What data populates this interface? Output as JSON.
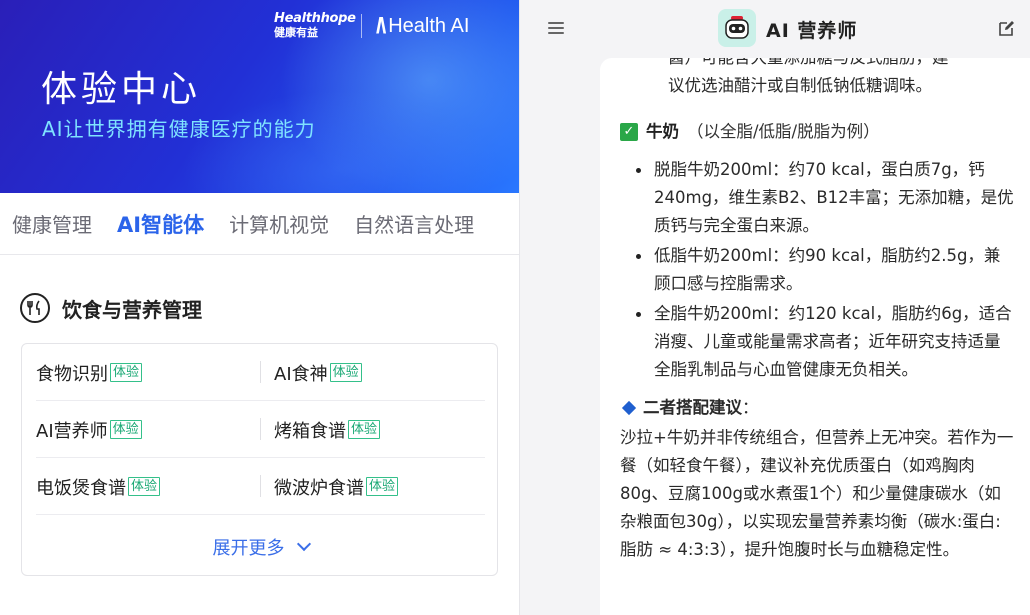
{
  "hero": {
    "brand_en": "Healthhope",
    "brand_cn": "健康有益",
    "brand_ai_logo": "/\\",
    "brand_ai_text": "Health AI",
    "title": "体验中心",
    "subtitle": "AI让世界拥有健康医疗的能力",
    "colors": {
      "gradient_start": "#2a1fb8",
      "gradient_end": "#2a78ff",
      "subtitle": "#7fe3ff"
    }
  },
  "tabs": [
    {
      "label": "健康管理",
      "active": false
    },
    {
      "label": "AI智能体",
      "active": true
    },
    {
      "label": "计算机视觉",
      "active": false
    },
    {
      "label": "自然语言处理",
      "active": false
    }
  ],
  "section": {
    "icon": "fork-knife-icon",
    "title": "饮食与营养管理",
    "badge": "体验",
    "rows": [
      [
        "食物识别",
        "AI食神"
      ],
      [
        "AI营养师",
        "烤箱食谱"
      ],
      [
        "电饭煲食谱",
        "微波炉食谱"
      ]
    ],
    "expand_label": "展开更多"
  },
  "chat": {
    "bot_name": "AI 营养师",
    "header_icons": [
      "menu-icon",
      "robot-avatar-icon",
      "edit-icon"
    ],
    "cut_lines": [
      "酱）可能含大量添加糖与反式脂肪，建",
      "议优选油醋汁或自制低钠低糖调味。"
    ],
    "milk_heading": "牛奶",
    "milk_note": "（以全脂/低脂/脱脂为例）",
    "milk_bullets": [
      "脱脂牛奶200ml：约70 kcal，蛋白质7g，钙240mg，维生素B2、B12丰富；无添加糖，是优质钙与完全蛋白来源。",
      "低脂牛奶200ml：约90 kcal，脂肪约2.5g，兼顾口感与控脂需求。",
      "全脂牛奶200ml：约120 kcal，脂肪约6g，适合消瘦、儿童或能量需求高者；近年研究支持适量全脂乳制品与心血管健康无负相关。"
    ],
    "combo_heading": "二者搭配建议",
    "combo_colon": "：",
    "combo_text": "沙拉+牛奶并非传统组合，但营养上无冲突。若作为一餐（如轻食午餐），建议补充优质蛋白（如鸡胸肉80g、豆腐100g或水煮蛋1个）和少量健康碳水（如杂粮面包30g），以实现宏量营养素均衡（碳水:蛋白:脂肪 ≈ 4:3:3），提升饱腹时长与血糖稳定性。",
    "colors": {
      "check": "#2aa748",
      "diamond": "#1f5fcf",
      "avatar_bg": "#c9f0e8"
    }
  }
}
